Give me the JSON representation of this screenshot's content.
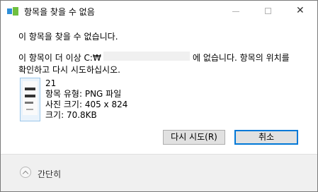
{
  "window": {
    "title": "항목을 찾을 수 없음",
    "close_glyph": "✕"
  },
  "message": {
    "headline": "이 항목을 찾을 수 없습니다.",
    "line1_prefix": "이 항목이 더 이상 C:₩",
    "line1_suffix": "에 없습니다. 항목의 위치를",
    "line2": "확인하고 다시 시도하십시오."
  },
  "file": {
    "name": "21",
    "type": "항목 유형: PNG 파일",
    "dimensions": "사진 크기: 405 x 824",
    "size": "크기: 70.8KB"
  },
  "buttons": {
    "retry": "다시 시도(R)",
    "cancel": "취소"
  },
  "footer": {
    "collapse_label": "간단히"
  }
}
